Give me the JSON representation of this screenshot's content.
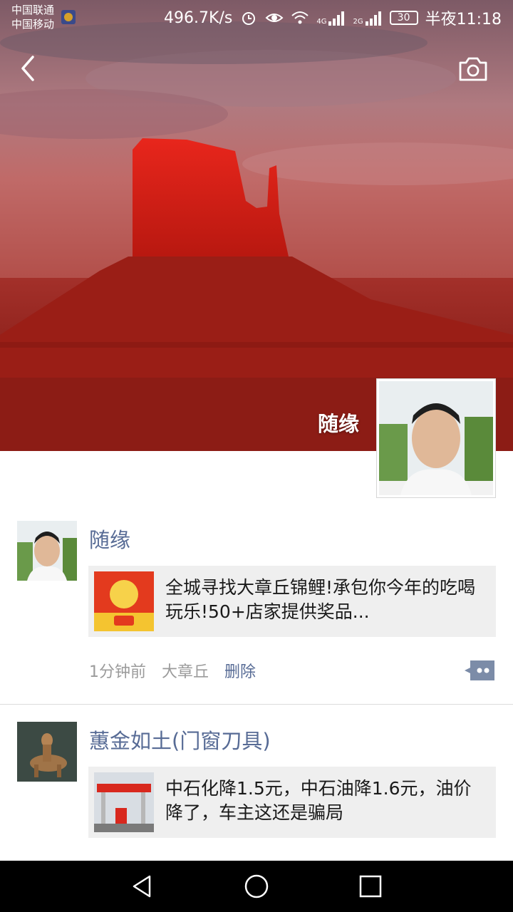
{
  "status_bar": {
    "carrier_1": "中国联通",
    "carrier_2": "中国移动",
    "net_speed": "496.7K/s",
    "signal_1_label": "4G",
    "signal_2_label": "2G",
    "battery": "30",
    "time": "半夜11:18"
  },
  "header": {
    "back_icon": "chevron-left-icon",
    "camera_icon": "camera-icon",
    "cover_name": "随缘"
  },
  "posts": [
    {
      "author": "随缘",
      "share_text": "全城寻找大章丘锦鲤!承包你今年的吃喝玩乐!50+店家提供奖品...",
      "time": "1分钟前",
      "location": "大章丘",
      "delete_label": "删除"
    },
    {
      "author": "蕙金如土(门窗刀具)",
      "share_text": "中石化降1.5元，中石油降1.6元，油价降了，车主这还是骗局"
    }
  ],
  "colors": {
    "name_link": "#576b95",
    "meta_gray": "#9b9b9b",
    "card_bg": "#efefef"
  }
}
